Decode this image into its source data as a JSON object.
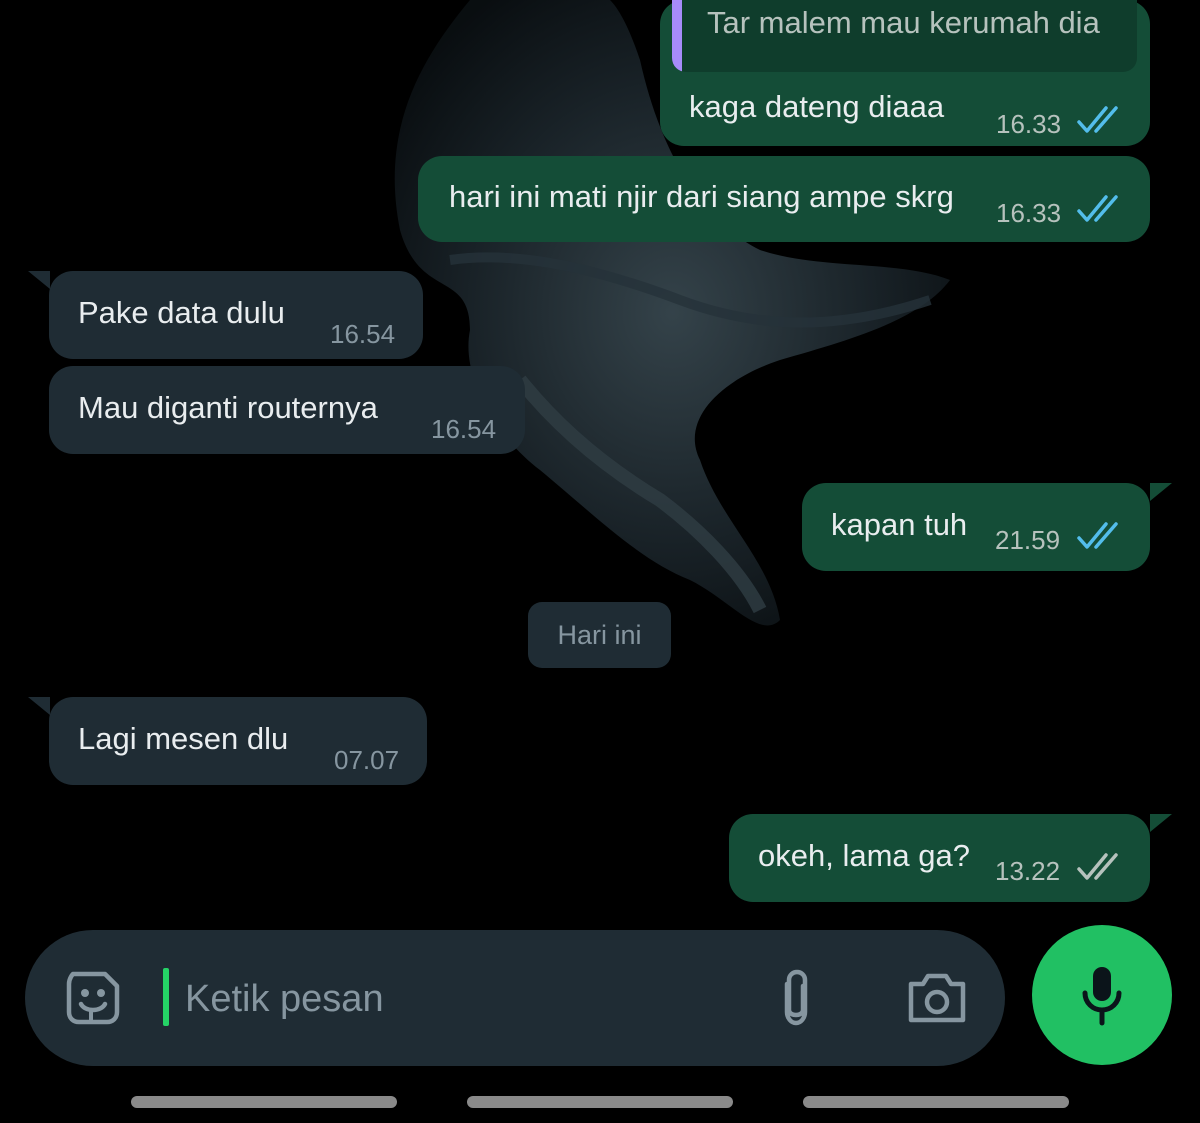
{
  "conversation": {
    "messages": [
      {
        "direction": "out",
        "quoted": "Tar malem mau kerumah dia",
        "text": "kaga dateng diaaa",
        "time": "16.33",
        "status": "read"
      },
      {
        "direction": "out",
        "text": "hari ini mati njir dari siang ampe skrg",
        "time": "16.33",
        "status": "read"
      },
      {
        "direction": "in",
        "text": "Pake data dulu",
        "time": "16.54"
      },
      {
        "direction": "in",
        "text": "Mau diganti routernya",
        "time": "16.54"
      },
      {
        "direction": "out",
        "text": "kapan tuh",
        "time": "21.59",
        "status": "read"
      },
      {
        "direction": "in",
        "text": "Lagi mesen dlu",
        "time": "07.07"
      },
      {
        "direction": "out",
        "text": "okeh, lama ga?",
        "time": "13.22",
        "status": "delivered"
      }
    ],
    "date_separator": "Hari ini"
  },
  "composer": {
    "placeholder": "Ketik pesan",
    "sticker_icon": "sticker-smile-icon",
    "attach_icon": "paperclip-icon",
    "camera_icon": "camera-icon",
    "mic_icon": "microphone-icon"
  },
  "colors": {
    "background": "#000000",
    "outgoing_bubble": "#144d37",
    "incoming_bubble": "#1f2c34",
    "read_ticks": "#53bdeb",
    "delivered_ticks": "#b6c2bd",
    "mic_button": "#21c063",
    "quote_bar": "#a78bfa"
  }
}
